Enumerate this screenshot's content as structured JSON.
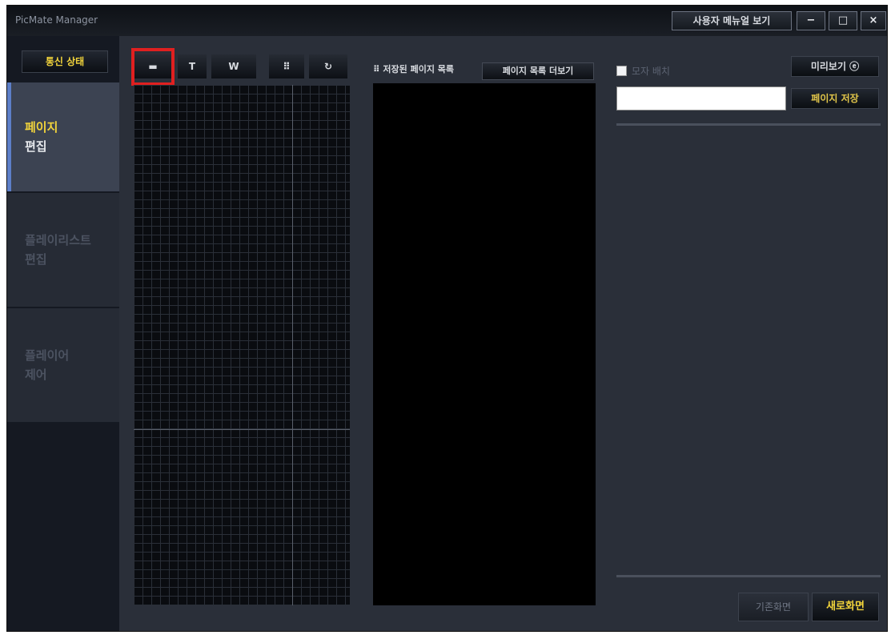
{
  "window": {
    "title": "PicMate Manager",
    "user_menu_label": "사용자 메뉴얼 보기",
    "minimize": "−",
    "maximize": "□",
    "close": "×"
  },
  "sidebar": {
    "status_label": "통신 상태",
    "items": [
      {
        "line1": "페이지",
        "line2": "편집",
        "active": true
      },
      {
        "line1": "플레이리스트",
        "line2": "편집",
        "active": false
      },
      {
        "line1": "플레이어",
        "line2": "제어",
        "active": false
      }
    ]
  },
  "editor": {
    "tools": [
      {
        "label": "▬",
        "icon": "image-icon"
      },
      {
        "label": "T",
        "icon": "text-icon"
      },
      {
        "label": "W",
        "icon": "web-icon"
      },
      {
        "label": "⠿",
        "icon": "grid-icon"
      },
      {
        "label": "↻",
        "icon": "refresh-icon"
      }
    ]
  },
  "saved_pages": {
    "header": "⠿ 저장된 페이지 목록",
    "expand_label": "페이지 목록 더보기"
  },
  "right_panel": {
    "checkbox_label": "모자 배치",
    "preview_label": "미리보기 ⓔ",
    "save_label": "페이지 저장",
    "cancel_label": "기존화면",
    "new_label": "새로화면"
  },
  "colors": {
    "accent_yellow": "#f2d43b",
    "highlight_red": "#e02020",
    "active_bar": "#5d7fc8"
  }
}
